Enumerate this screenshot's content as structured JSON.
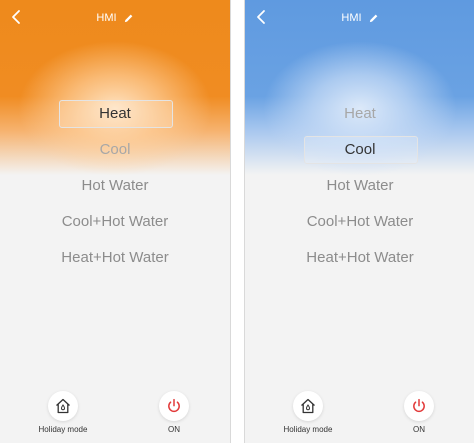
{
  "colors": {
    "heat_accent": "#f08c22",
    "cool_accent": "#6aa2e3",
    "power_icon": "#e23b3b"
  },
  "screens": [
    {
      "title": "HMI",
      "theme": "heat",
      "modes": [
        {
          "label": "Heat",
          "selected": true
        },
        {
          "label": "Cool",
          "selected": false
        },
        {
          "label": "Hot Water",
          "selected": false
        },
        {
          "label": "Cool+Hot Water",
          "selected": false
        },
        {
          "label": "Heat+Hot Water",
          "selected": false
        }
      ],
      "bottom": {
        "holiday_label": "Holiday mode",
        "power_label": "ON"
      }
    },
    {
      "title": "HMI",
      "theme": "cool",
      "modes": [
        {
          "label": "Heat",
          "selected": false
        },
        {
          "label": "Cool",
          "selected": true
        },
        {
          "label": "Hot Water",
          "selected": false
        },
        {
          "label": "Cool+Hot Water",
          "selected": false
        },
        {
          "label": "Heat+Hot Water",
          "selected": false
        }
      ],
      "bottom": {
        "holiday_label": "Holiday mode",
        "power_label": "ON"
      }
    }
  ],
  "icons": {
    "back": "chevron-left-icon",
    "edit": "pencil-icon",
    "holiday": "house-icon",
    "power": "power-icon"
  }
}
